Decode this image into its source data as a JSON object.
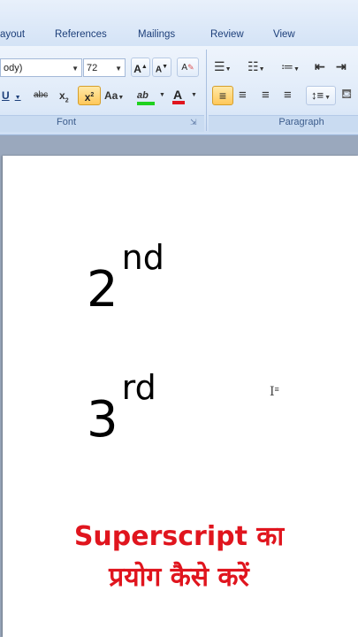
{
  "tabs": [
    "ayout",
    "References",
    "Mailings",
    "Review",
    "View"
  ],
  "font_group": {
    "font_name": "ody)",
    "font_size": "72",
    "grow_font_label": "A",
    "shrink_font_label": "A",
    "clear_format_label": "A",
    "underline_label": "U",
    "strike_label": "abc",
    "subscript_label": "x",
    "subscript_mark": "2",
    "superscript_label": "x",
    "superscript_mark": "2",
    "change_case_label": "Aa",
    "highlight_label": "ab",
    "font_color_label": "A",
    "label": "Font"
  },
  "paragraph_group": {
    "label": "Paragraph"
  },
  "document": {
    "line1_num": "2",
    "line1_sup": "nd",
    "line2_num": "3",
    "line2_sup": "rd"
  },
  "caption": {
    "line1": "Superscript का",
    "line2": "प्रयोग कैसे करें"
  },
  "colors": {
    "caption": "#e0151e",
    "ribbon": "#dde9f8",
    "highlight_bar": "#1fd11f",
    "font_color_bar": "#e0151e",
    "active_button": "#ffc85a"
  }
}
